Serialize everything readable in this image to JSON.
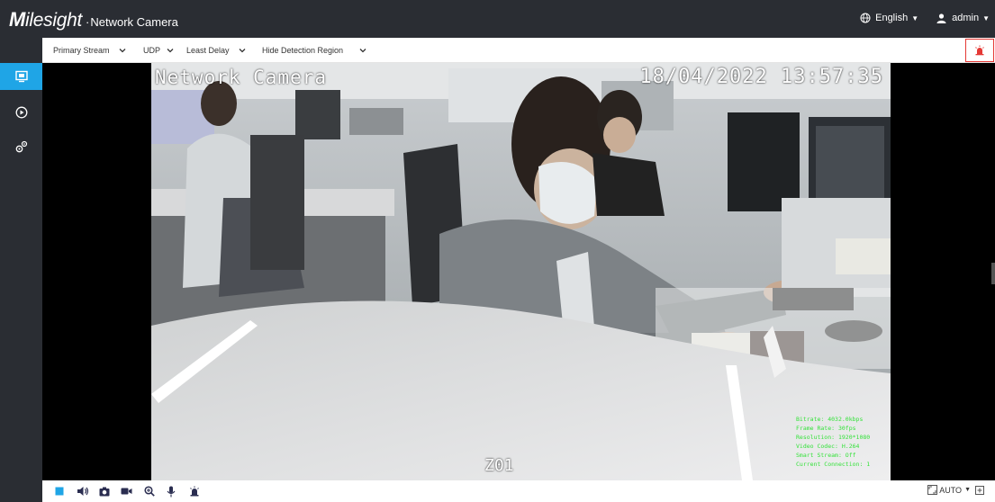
{
  "header": {
    "brand_logo_lead": "M",
    "brand_logo_rest": "ilesight",
    "brand_separator": "·",
    "product": "Network Camera",
    "language": "English",
    "user": "admin"
  },
  "toolbar": {
    "stream": "Primary Stream",
    "protocol": "UDP",
    "delay": "Least Delay",
    "detection": "Hide Detection Region"
  },
  "video": {
    "osd_name": "Network Camera",
    "osd_timestamp": "18/04/2022 13:57:35",
    "zone_label": "Z01",
    "stats": [
      "Bitrate: 4032.0kbps",
      "Frame Rate: 30fps",
      "Resolution: 1920*1080",
      "Video Codec: H.264",
      "Smart Stream: Off",
      "Current Connection: 1"
    ]
  },
  "bottom": {
    "zoom_mode": "AUTO"
  },
  "colors": {
    "header_bg": "#2a2d33",
    "accent": "#1fa5e6",
    "alert": "#e53935",
    "osd_stats": "#34e23a"
  },
  "icons": {
    "language": "globe-icon",
    "user": "user-icon",
    "nav": [
      "live-view-icon",
      "playback-icon",
      "settings-icon"
    ],
    "alarm": "alarm-icon",
    "controls": [
      "stop-icon",
      "volume-icon",
      "snapshot-icon",
      "record-icon",
      "zoom-icon",
      "microphone-icon",
      "alarm-output-icon"
    ]
  }
}
